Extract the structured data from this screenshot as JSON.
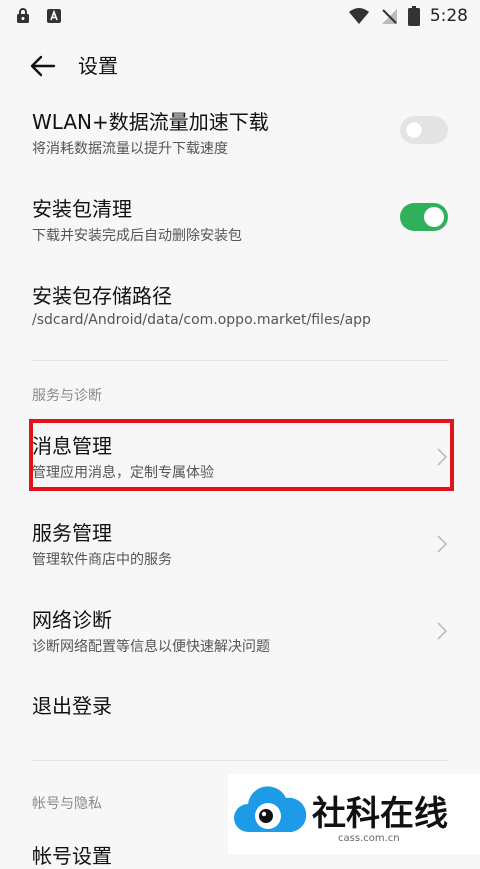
{
  "status_bar": {
    "time": "5:28",
    "left_icons": [
      "lock-icon",
      "app-store-icon"
    ],
    "right_icons": [
      "wifi-icon",
      "no-signal-icon",
      "battery-icon"
    ]
  },
  "header": {
    "title": "设置"
  },
  "settings": {
    "wlan_speed": {
      "title": "WLAN+数据流量加速下载",
      "subtitle": "将消耗数据流量以提升下载速度",
      "enabled": false
    },
    "pkg_cleanup": {
      "title": "安装包清理",
      "subtitle": "下载并安装完成后自动删除安装包",
      "enabled": true
    },
    "pkg_path": {
      "title": "安装包存储路径",
      "subtitle": "/sdcard/Android/data/com.oppo.market/files/app"
    }
  },
  "sections": {
    "service_diag": {
      "label": "服务与诊断",
      "items": [
        {
          "title": "消息管理",
          "subtitle": "管理应用消息，定制专属体验"
        },
        {
          "title": "服务管理",
          "subtitle": "管理软件商店中的服务"
        },
        {
          "title": "网络诊断",
          "subtitle": "诊断网络配置等信息以便快速解决问题"
        }
      ],
      "logout": "退出登录"
    },
    "account_privacy": {
      "label": "帐号与隐私",
      "first_item": "帐号设置"
    }
  },
  "watermark": {
    "text": "社科在线",
    "url": "cass.com.cn"
  },
  "colors": {
    "accent_green": "#2fb15b",
    "highlight_red": "#e1141b",
    "watermark_blue": "#1e9be8"
  }
}
